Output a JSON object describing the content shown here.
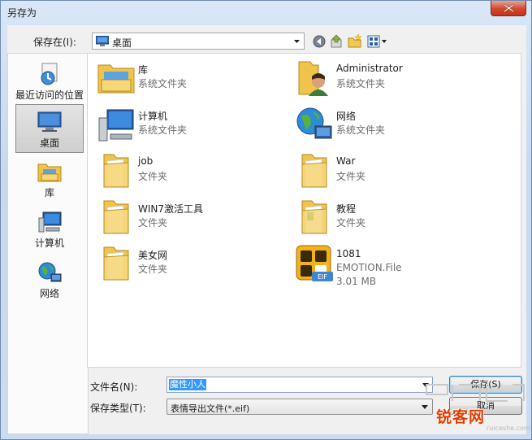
{
  "window": {
    "title": "另存为"
  },
  "toolbar": {
    "save_in_label": "保存在(I):",
    "location": "桌面"
  },
  "sidebar": {
    "items": [
      {
        "label": "最近访问的位置",
        "icon": "recent-places-icon"
      },
      {
        "label": "桌面",
        "icon": "desktop-icon",
        "selected": true
      },
      {
        "label": "库",
        "icon": "libraries-icon"
      },
      {
        "label": "计算机",
        "icon": "computer-icon"
      },
      {
        "label": "网络",
        "icon": "network-icon"
      }
    ]
  },
  "files": [
    {
      "name": "库",
      "type": "系统文件夹",
      "icon": "libraries-icon"
    },
    {
      "name": "Administrator",
      "type": "系统文件夹",
      "icon": "user-folder-icon"
    },
    {
      "name": "计算机",
      "type": "系统文件夹",
      "icon": "computer-icon"
    },
    {
      "name": "网络",
      "type": "系统文件夹",
      "icon": "network-icon"
    },
    {
      "name": "job",
      "type": "文件夹",
      "icon": "folder-icon"
    },
    {
      "name": "War",
      "type": "文件夹",
      "icon": "folder-icon"
    },
    {
      "name": "WIN7激活工具",
      "type": "文件夹",
      "icon": "folder-icon"
    },
    {
      "name": "教程",
      "type": "文件夹",
      "icon": "folder-icon"
    },
    {
      "name": "美女网",
      "type": "文件夹",
      "icon": "folder-icon"
    },
    {
      "name": "1081",
      "type": "EMOTION.File",
      "size": "3.01 MB",
      "icon": "qq-emotion-file-icon"
    }
  ],
  "bottom": {
    "filename_label": "文件名(N):",
    "filename_value": "魔性小人",
    "filetype_label": "保存类型(T):",
    "filetype_value": "表情导出文件(*.eif)",
    "save_button": "保存(S)",
    "cancel_button": "取消"
  },
  "watermark": {
    "text": "锐客网",
    "sub": "ruiceshe.com"
  },
  "colors": {
    "accent": "#3399ff",
    "close": "#c7462f",
    "watermark": "#e23d00"
  }
}
